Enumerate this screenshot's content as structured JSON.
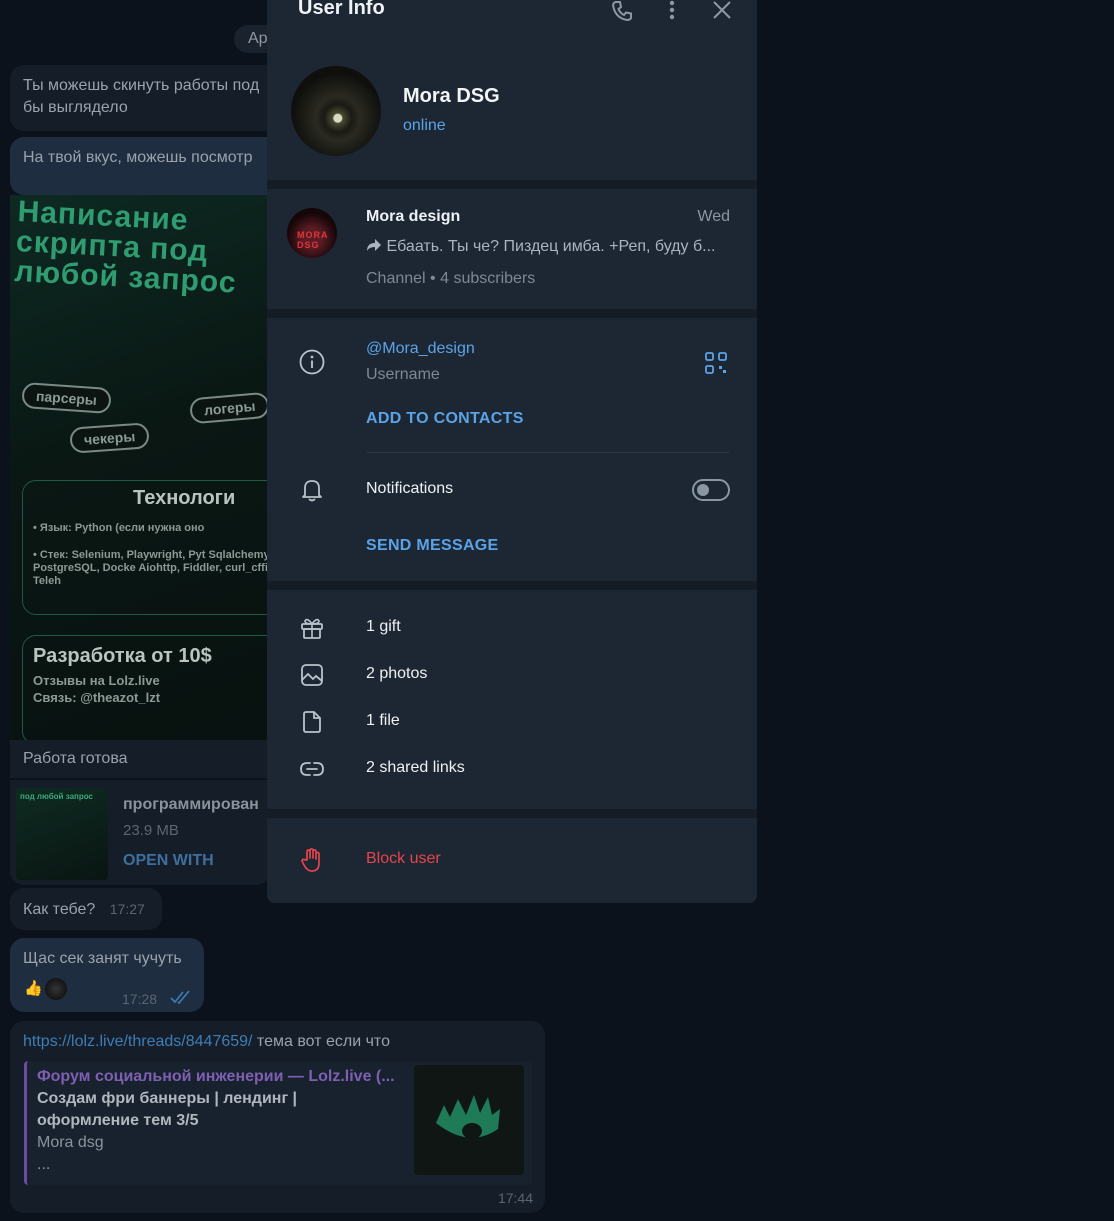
{
  "background_chat": {
    "date_pill": "Ap",
    "msg1": "Ты можешь скинуть работы под бы выглядело",
    "msg2": "На твой вкус, можешь посмотр",
    "poster": {
      "title": "Написание скрипта под любой запрос",
      "tags": [
        "парсеры",
        "логеры",
        "чекеры"
      ],
      "tech_title": "Технологи",
      "tech_lines": [
        "• Язык: Python (если нужна оно",
        "• Стек: Selenium, Playwright, Pyt Sqlalchemy, PostgreSQL, Docke Aiohttp, Fiddler, curl_cffi, Teleh"
      ],
      "price_title": "Разработка от 10$",
      "reviews": "Отзывы на Lolz.live",
      "contact": "Связь: @theazot_lzt"
    },
    "msg3": "Работа готова",
    "file": {
      "name": "программирован",
      "size": "23.9 MB",
      "action": "OPEN WITH",
      "thumb_text": "под любой запрос"
    },
    "msg4": {
      "text": "Как тебе?",
      "time": "17:27"
    },
    "msg5": {
      "text": "Щас сек занят чучуть",
      "time": "17:28",
      "reaction": "👍"
    },
    "msg6": {
      "link": "https://lolz.live/threads/8447659/",
      "text": " тема вот если что",
      "preview_site": "Форум социальной инженерии — Lolz.live (...",
      "preview_title": "Создам фри баннеры | лендинг | оформление тем 3/5",
      "preview_desc": "Mora dsg",
      "preview_more": "...",
      "time": "17:44"
    }
  },
  "panel": {
    "title": "User Info",
    "user": {
      "name": "Mora DSG",
      "status": "online"
    },
    "channel": {
      "name": "Mora design",
      "day": "Wed",
      "last_message": "Ебаать. Ты че? Пиздец имба. +Реп, буду б...",
      "subtitle": "Channel • 4 subscribers",
      "avatar_text": "MORA DSG"
    },
    "username": {
      "value": "@Mora_design",
      "label": "Username"
    },
    "add_contacts": "ADD TO CONTACTS",
    "notifications": {
      "label": "Notifications",
      "enabled": false
    },
    "send_message": "SEND MESSAGE",
    "media": [
      {
        "icon": "gift-icon",
        "label": "1 gift"
      },
      {
        "icon": "photo-icon",
        "label": "2 photos"
      },
      {
        "icon": "file-icon",
        "label": "1 file"
      },
      {
        "icon": "link-icon",
        "label": "2 shared links"
      }
    ],
    "block": "Block user"
  },
  "colors": {
    "panel_bg": "#1d2733",
    "accent": "#5aa3e8",
    "danger": "#e5444c",
    "chat_bg": "#0c121b"
  }
}
